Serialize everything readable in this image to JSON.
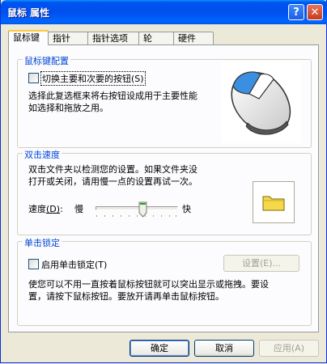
{
  "window": {
    "title": "鼠标 属性",
    "help_label": "?",
    "close_label": "✕"
  },
  "tabs": [
    {
      "label": "鼠标键"
    },
    {
      "label": "指针"
    },
    {
      "label": "指针选项"
    },
    {
      "label": "轮"
    },
    {
      "label": "硬件"
    }
  ],
  "button_config": {
    "title": "鼠标键配置",
    "switch_label": "切换主要和次要的按钮",
    "switch_shortcut": "(S)",
    "switch_checked": false,
    "description_line1": "选择此复选框来将右按钮设成用于主要性能",
    "description_line2": "如选择和拖放之用。"
  },
  "double_click": {
    "title": "双击速度",
    "description_line1": "双击文件夹以检测您的设置。如果文件夹没",
    "description_line2": "打开或关闭，请用慢一点的设置再试一次。",
    "speed_label": "速度",
    "speed_shortcut": "(D)",
    "speed_colon": ":",
    "slow_label": "慢",
    "fast_label": "快",
    "slider_value_fraction": 0.58
  },
  "click_lock": {
    "title": "单击锁定",
    "enable_label": "启用单击锁定",
    "enable_shortcut": "(T)",
    "enable_checked": false,
    "settings_button": "设置(E)...",
    "description_line1": "使您可以不用一直按着鼠标按钮就可以突出显示或拖拽。要设",
    "description_line2": "置，请按下鼠标按钮。要放开请再单击鼠标按钮。"
  },
  "footer": {
    "ok_label": "确定",
    "cancel_label": "取消",
    "apply_label": "应用(A)"
  },
  "colors": {
    "accent": "#0046d5",
    "title_bar": "#0054e3",
    "tab_highlight": "#ffc83c"
  }
}
